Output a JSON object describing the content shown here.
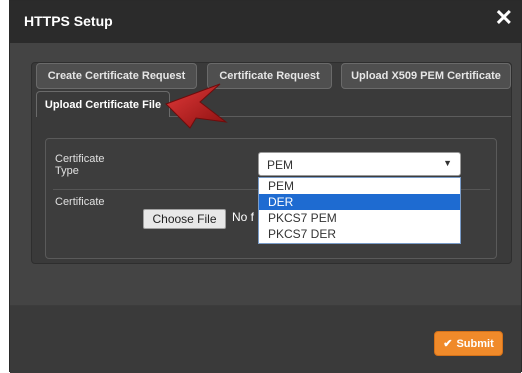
{
  "dialog": {
    "title": "HTTPS Setup",
    "close_glyph": "✕"
  },
  "tabs": [
    {
      "label": "Create Certificate Request",
      "active": false
    },
    {
      "label": "Certificate Request",
      "active": false
    },
    {
      "label": "Upload X509 PEM Certificate",
      "active": false
    },
    {
      "label": "Upload Certificate File",
      "active": true
    }
  ],
  "form": {
    "certificate_type_label": "Certificate Type",
    "certificate_type_line1": "Certificate",
    "certificate_type_line2": "Type",
    "certificate_type_value": "PEM",
    "certificate_type_options": [
      "PEM",
      "DER",
      "PKCS7 PEM",
      "PKCS7 DER"
    ],
    "highlighted_option": "DER",
    "certificate_label": "Certificate",
    "choose_file_label": "Choose File",
    "no_file_text": "No f"
  },
  "footer": {
    "submit_label": "Submit",
    "submit_icon": "check-icon"
  },
  "colors": {
    "accent": "#f08a2a",
    "selection": "#1e6bd1",
    "pointer": "#cc1f1f"
  }
}
